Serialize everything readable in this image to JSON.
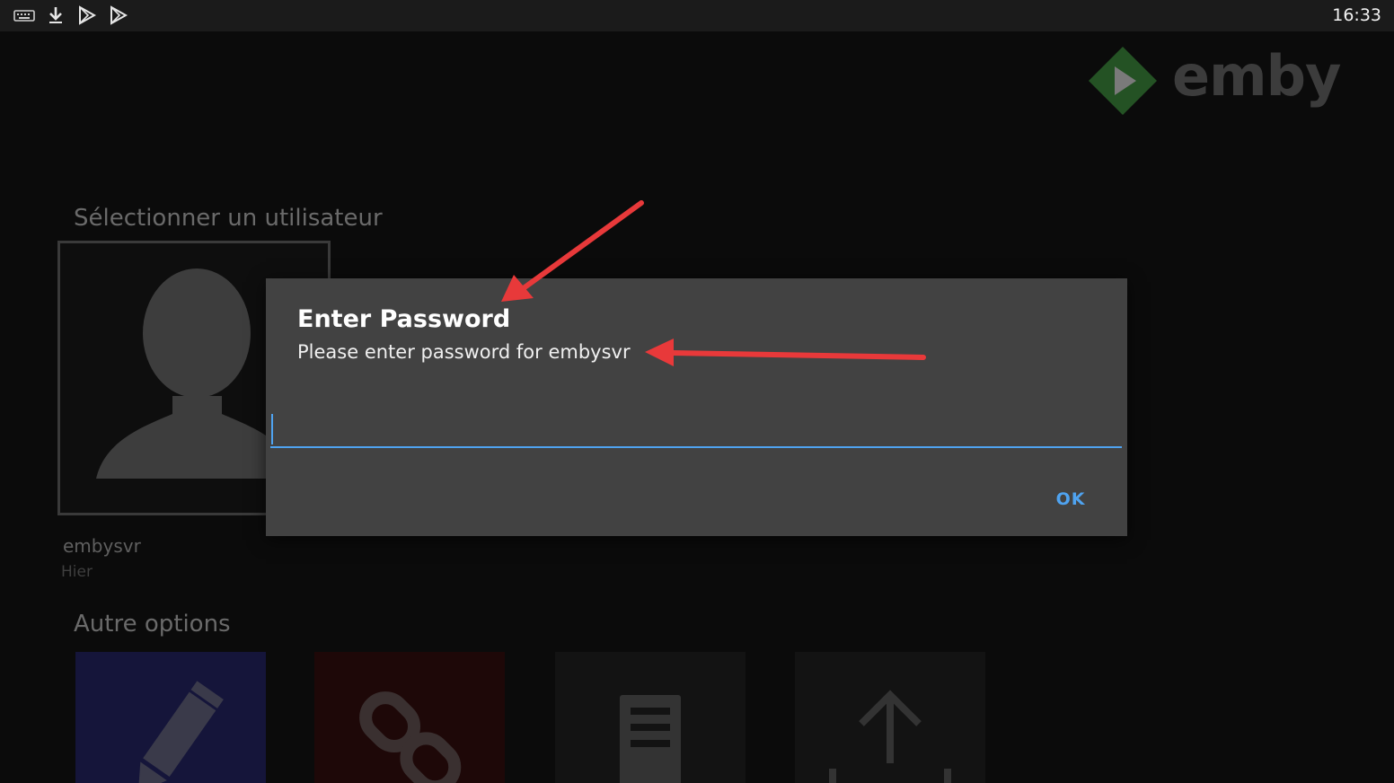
{
  "status_bar": {
    "icons": [
      "keyboard-icon",
      "download-icon",
      "play-store-icon",
      "play-store-icon"
    ],
    "time": "16:33"
  },
  "logo": {
    "text": "emby"
  },
  "user_section": {
    "title": "Sélectionner un utilisateur",
    "user": {
      "name": "embysvr",
      "last_seen": "Hier"
    }
  },
  "options_section": {
    "title": "Autre options",
    "tiles": [
      {
        "icon": "pencil-icon",
        "color": "#15153a"
      },
      {
        "icon": "link-icon",
        "color": "#1e0808"
      },
      {
        "icon": "server-icon",
        "color": "#131313"
      },
      {
        "icon": "upload-icon",
        "color": "#131313"
      }
    ]
  },
  "dialog": {
    "title": "Enter Password",
    "message": "Please enter password for embysvr",
    "password_value": "",
    "ok_label": "OK"
  },
  "colors": {
    "accent": "#4fa3f0",
    "dialog_bg": "#424242",
    "annotation_arrow": "#e8393a",
    "logo_green": "#2f6b2f"
  }
}
